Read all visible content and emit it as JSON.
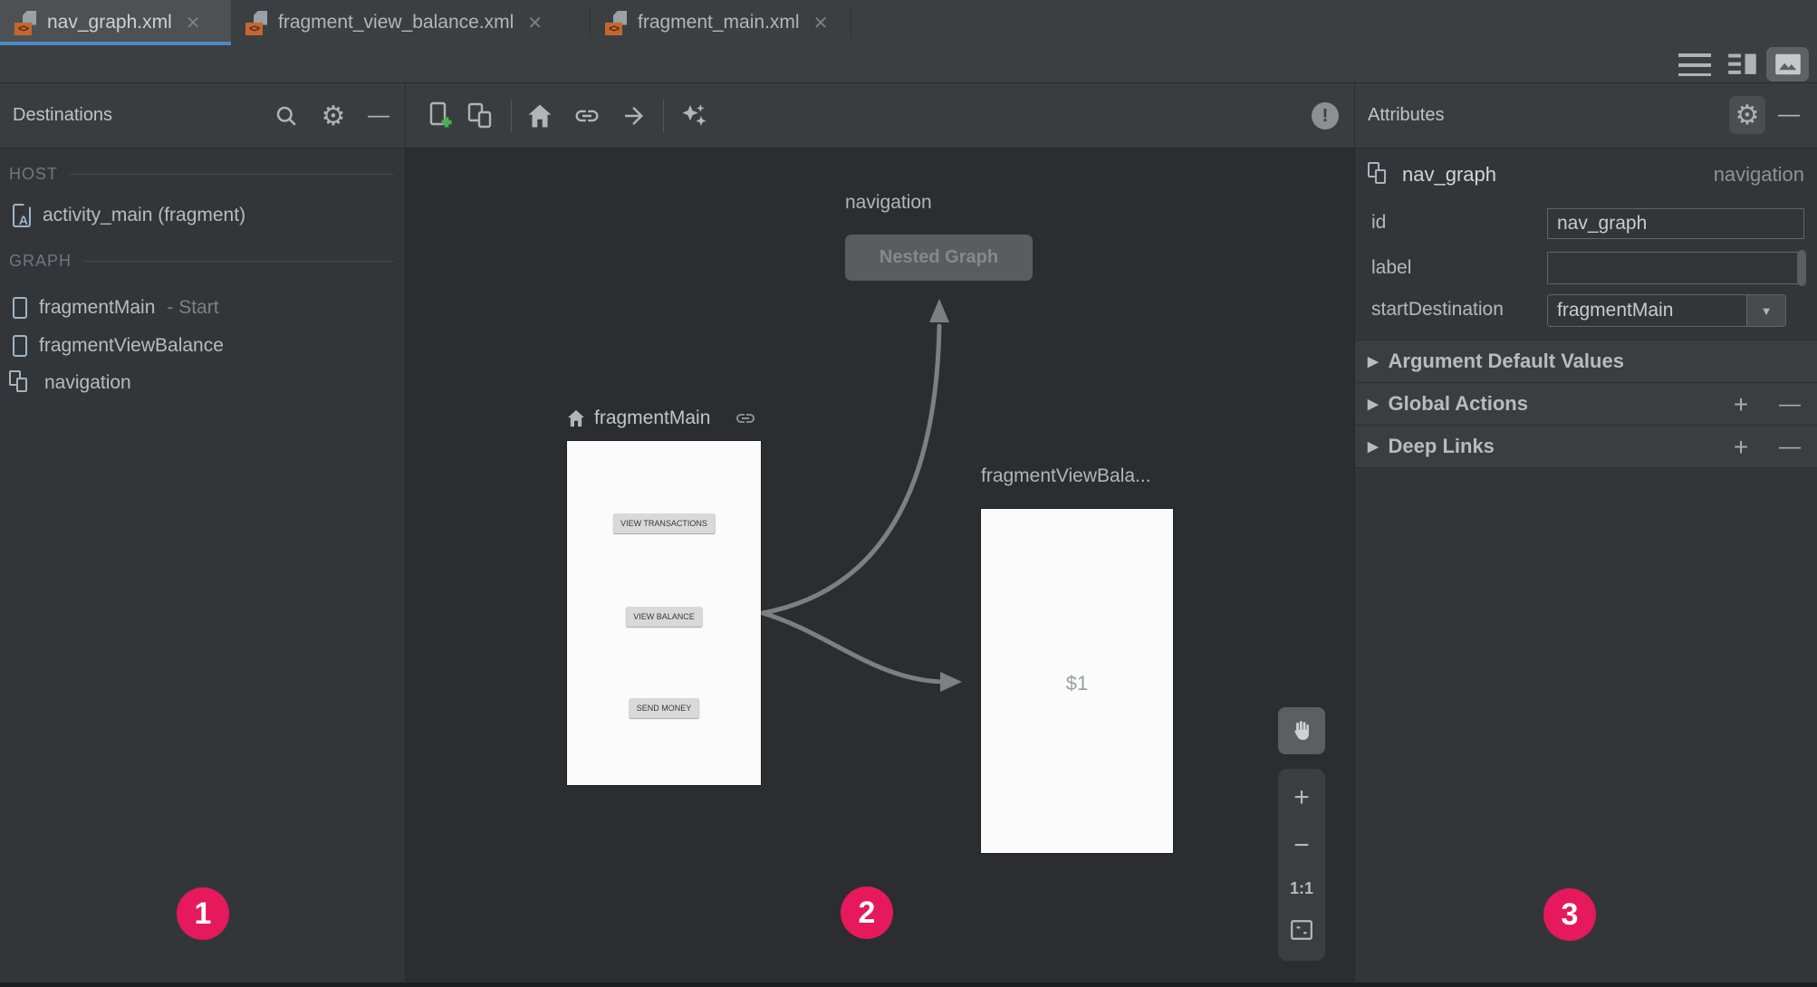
{
  "icons": {
    "xml_glyph": "<>",
    "close": "✕",
    "gear": "⚙",
    "minus": "—",
    "collapse_arrow": "▶",
    "dropdown_arrow": "▼",
    "plus": "+",
    "warning": "!",
    "activity_glyph": "A"
  },
  "tabs": [
    {
      "label": "nav_graph.xml",
      "active": true
    },
    {
      "label": "fragment_view_balance.xml",
      "active": false
    },
    {
      "label": "fragment_main.xml",
      "active": false
    }
  ],
  "destinations_panel": {
    "title": "Destinations",
    "host_section": {
      "label": "HOST",
      "items": [
        {
          "name": "activity_main (fragment)",
          "icon": "activity-fragment"
        }
      ]
    },
    "graph_section": {
      "label": "GRAPH",
      "items": [
        {
          "name": "fragmentMain",
          "suffix": "- Start",
          "icon": "fragment"
        },
        {
          "name": "fragmentViewBalance",
          "suffix": "",
          "icon": "fragment"
        },
        {
          "name": "navigation",
          "suffix": "",
          "icon": "nested-graph"
        }
      ]
    }
  },
  "canvas": {
    "nested_graph_label": "navigation",
    "nested_graph_button": "Nested Graph",
    "fragment_main": {
      "title": "fragmentMain",
      "buttons": [
        "VIEW TRANSACTIONS",
        "VIEW BALANCE",
        "SEND MONEY"
      ]
    },
    "fragment_view_balance": {
      "title": "fragmentViewBala...",
      "content": "$1"
    },
    "zoom_controls": {
      "zoom_in": "+",
      "zoom_out": "−",
      "actual_size": "1:1"
    }
  },
  "attributes_panel": {
    "title": "Attributes",
    "component": {
      "name": "nav_graph",
      "type": "navigation"
    },
    "fields": {
      "id": {
        "label": "id",
        "value": "nav_graph"
      },
      "label": {
        "label": "label",
        "value": ""
      },
      "start_destination": {
        "label": "startDestination",
        "value": "fragmentMain"
      }
    },
    "sections": [
      {
        "label": "Argument Default Values"
      },
      {
        "label": "Global Actions"
      },
      {
        "label": "Deep Links"
      }
    ]
  },
  "annotations": [
    {
      "number": "1"
    },
    {
      "number": "2"
    },
    {
      "number": "3"
    }
  ],
  "colors": {
    "tab_accent": "#4A88C7",
    "annotation": "#E5195C",
    "canvas_bg": "#2B2D30",
    "panel_bg": "#333639",
    "card_bg": "#FBFBFB",
    "arrow": "#7D8082"
  }
}
